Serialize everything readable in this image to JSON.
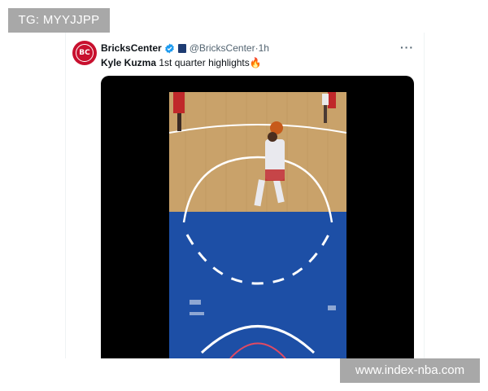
{
  "overlay": {
    "tg_label": "TG: MYYJJPP",
    "watermark_label": "www.index-nba.com"
  },
  "tweet": {
    "author": {
      "display_name": "BricksCenter",
      "handle": "@BricksCenter",
      "avatar_text": "BC",
      "verified": true
    },
    "separator": " · ",
    "timestamp": "1h",
    "more_icon": "···",
    "text_bold": "Kyle Kuzma",
    "text_rest": " 1st quarter highlights",
    "text_emoji": "🔥",
    "media": {
      "type": "video",
      "description_icon": "basketball-court-video"
    }
  },
  "colors": {
    "brand_red": "#c8102e",
    "verified_blue": "#1d9bf0",
    "court_wood": "#c9a26a",
    "court_blue": "#1d4fa6",
    "overlay_gray": "#a8a8a8"
  }
}
